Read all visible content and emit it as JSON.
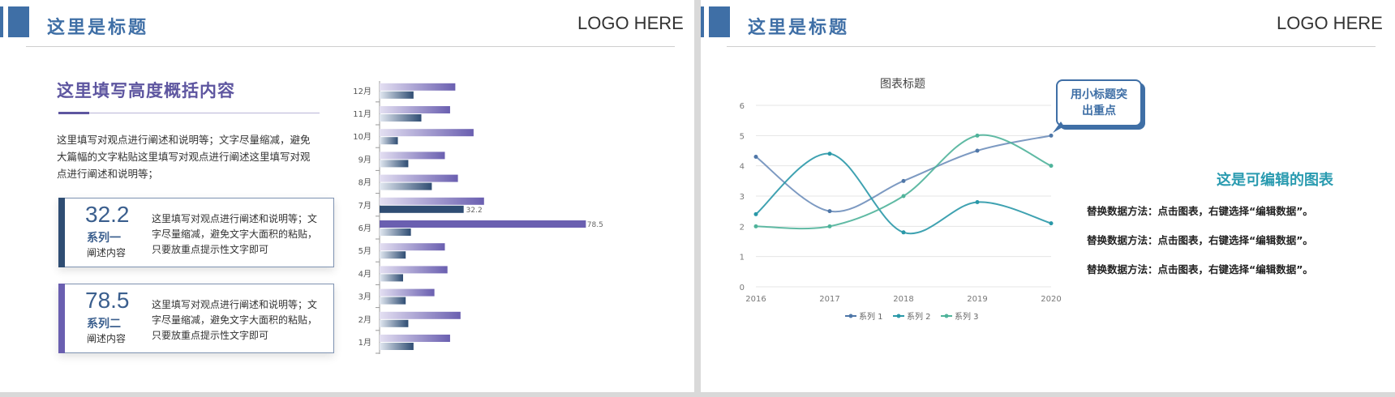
{
  "colors": {
    "accent": "#3f6fa6",
    "purple": "#5e56a0",
    "teal": "#2a9bb0"
  },
  "slide1": {
    "title": "这里是标题",
    "logo": "LOGO HERE",
    "heading": "这里填写高度概括内容",
    "paragraph": "这里填写对观点进行阐述和说明等；文字尽量缩减，避免大篇幅的文字粘贴这里填写对观点进行阐述这里填写对观点进行阐述和说明等；",
    "cards": [
      {
        "value": "32.2",
        "series": "系列一",
        "sub": "阐述内容",
        "desc": "这里填写对观点进行阐述和说明等；文字尽量缩减，避免文字大面积的粘贴，只要放重点提示性文字即可"
      },
      {
        "value": "78.5",
        "series": "系列二",
        "sub": "阐述内容",
        "desc": "这里填写对观点进行阐述和说明等；文字尽量缩减，避免文字大面积的粘贴，只要放重点提示性文字即可"
      }
    ]
  },
  "slide2": {
    "title": "这里是标题",
    "logo": "LOGO HERE",
    "callout": [
      "用小标题突",
      "出重点"
    ],
    "editable_title": "这是可编辑的图表",
    "replace_lines": [
      "替换数据方法：点击图表，右键选择“编辑数据”。",
      "替换数据方法：点击图表，右键选择“编辑数据”。",
      "替换数据方法：点击图表，右键选择“编辑数据”。"
    ]
  },
  "chart_data": [
    {
      "type": "bar",
      "orientation": "horizontal",
      "categories": [
        "1月",
        "2月",
        "3月",
        "4月",
        "5月",
        "6月",
        "7月",
        "8月",
        "9月",
        "10月",
        "11月",
        "12月"
      ],
      "series": [
        {
          "values": [
            27,
            31,
            21,
            26,
            25,
            79,
            40,
            30,
            25,
            36,
            27,
            29
          ]
        },
        {
          "values": [
            13,
            11,
            10,
            9,
            10,
            12,
            32.2,
            20,
            11,
            7,
            16,
            13
          ]
        }
      ],
      "data_labels": [
        {
          "category": "6月",
          "value": "78.5"
        },
        {
          "category": "7月",
          "value": "32.2"
        }
      ]
    },
    {
      "type": "line",
      "title": "图表标题",
      "x": [
        "2016",
        "2017",
        "2018",
        "2019",
        "2020"
      ],
      "ylim": [
        0,
        6
      ],
      "yticks": [
        "0",
        "1",
        "2",
        "3",
        "4",
        "5",
        "6"
      ],
      "grid": true,
      "legend": "bottom",
      "series": [
        {
          "name": "系列 1",
          "values": [
            4.3,
            2.5,
            3.5,
            4.5,
            5.0
          ],
          "color": "#4f77a8"
        },
        {
          "name": "系列 2",
          "values": [
            2.4,
            4.4,
            1.8,
            2.8,
            2.1
          ],
          "color": "#2a98a8"
        },
        {
          "name": "系列 3",
          "values": [
            2.0,
            2.0,
            3.0,
            5.0,
            4.0
          ],
          "color": "#4fb39a"
        }
      ]
    }
  ]
}
